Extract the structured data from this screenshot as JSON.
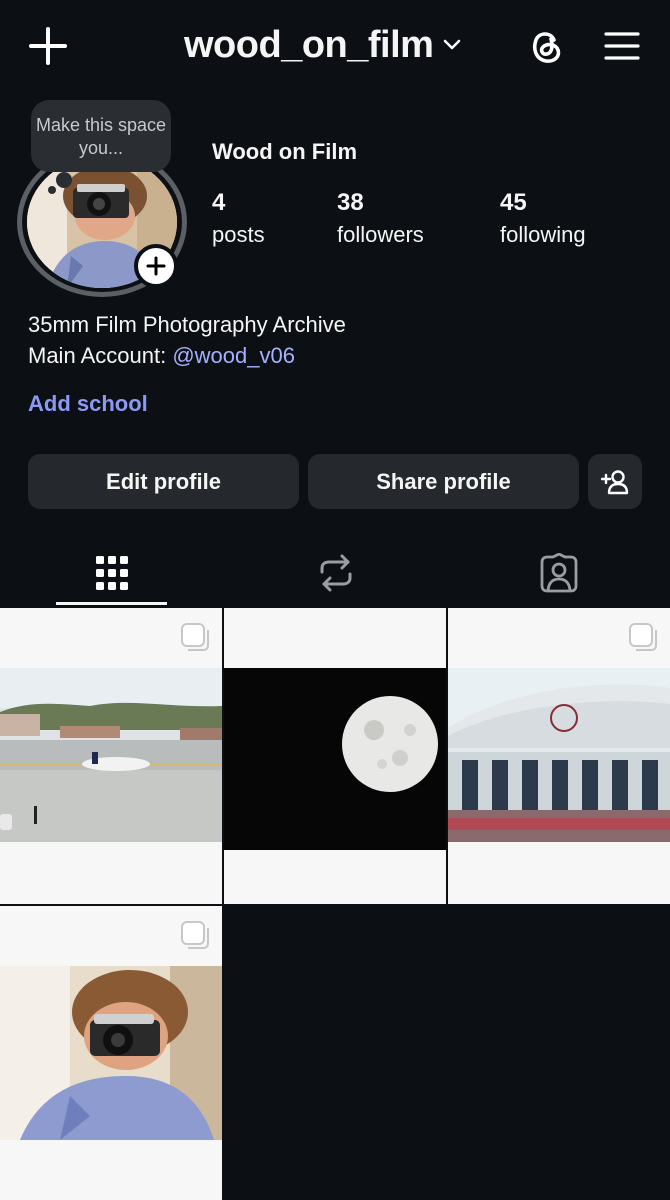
{
  "header": {
    "username": "wood_on_film",
    "create_icon": "plus-icon",
    "threads_icon": "threads-icon",
    "menu_icon": "hamburger-menu-icon"
  },
  "profile": {
    "note_text": "Make this space you...",
    "display_name": "Wood on Film",
    "stats": {
      "posts_count": "4",
      "posts_label": "posts",
      "followers_count": "38",
      "followers_label": "followers",
      "following_count": "45",
      "following_label": "following"
    },
    "bio_line1": "35mm Film Photography Archive",
    "bio_line2_prefix": "Main Account: ",
    "bio_mention": "@wood_v06",
    "add_school": "Add school"
  },
  "actions": {
    "edit_label": "Edit profile",
    "share_label": "Share profile",
    "suggest_icon": "add-person-icon"
  },
  "tabs": [
    {
      "name": "grid",
      "icon": "grid-icon",
      "selected": true
    },
    {
      "name": "reposts",
      "icon": "repost-icon",
      "selected": false
    },
    {
      "name": "tagged",
      "icon": "tagged-person-icon",
      "selected": false
    }
  ],
  "posts": [
    {
      "subject": "airplane on runway",
      "multi": true
    },
    {
      "subject": "full moon",
      "multi": false
    },
    {
      "subject": "coliseum",
      "multi": true
    },
    {
      "subject": "self portrait with camera",
      "multi": true
    }
  ],
  "colors": {
    "background": "#0c1014",
    "button": "#25292e",
    "link": "#8d98f5",
    "mention": "#a5b1ff"
  }
}
